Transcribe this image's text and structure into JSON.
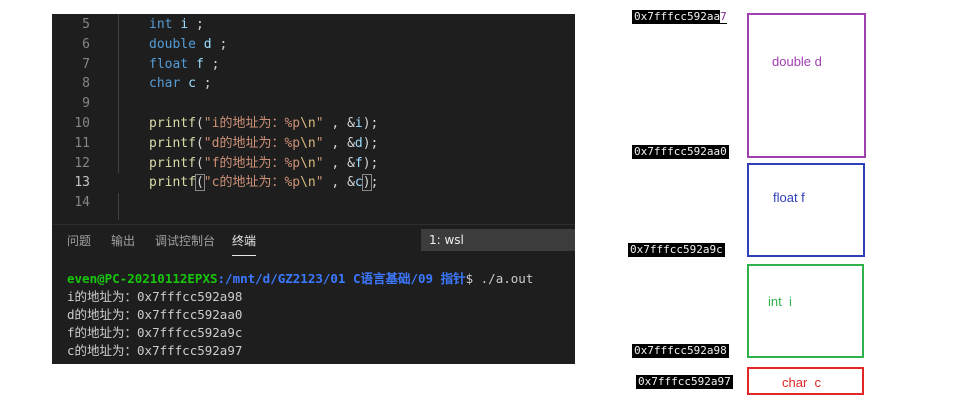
{
  "editor": {
    "lines": [
      {
        "num": "5",
        "current": false,
        "tokens": [
          {
            "t": "int",
            "c": "kw"
          },
          {
            "t": " ",
            "c": "pl"
          },
          {
            "t": "i",
            "c": "id"
          },
          {
            "t": " ;",
            "c": "pl"
          }
        ]
      },
      {
        "num": "6",
        "current": false,
        "tokens": [
          {
            "t": "double",
            "c": "kw"
          },
          {
            "t": " ",
            "c": "pl"
          },
          {
            "t": "d",
            "c": "id"
          },
          {
            "t": " ;",
            "c": "pl"
          }
        ]
      },
      {
        "num": "7",
        "current": false,
        "tokens": [
          {
            "t": "float",
            "c": "kw"
          },
          {
            "t": " ",
            "c": "pl"
          },
          {
            "t": "f",
            "c": "id"
          },
          {
            "t": " ;",
            "c": "pl"
          }
        ]
      },
      {
        "num": "8",
        "current": false,
        "tokens": [
          {
            "t": "char",
            "c": "kw"
          },
          {
            "t": " ",
            "c": "pl"
          },
          {
            "t": "c",
            "c": "id"
          },
          {
            "t": " ;",
            "c": "pl"
          }
        ]
      },
      {
        "num": "9",
        "current": false,
        "tokens": []
      },
      {
        "num": "10",
        "current": false,
        "tokens": [
          {
            "t": "printf",
            "c": "fn"
          },
          {
            "t": "(",
            "c": "pl"
          },
          {
            "t": "\"i的地址为：%p",
            "c": "str"
          },
          {
            "t": "\\n",
            "c": "esc"
          },
          {
            "t": "\"",
            "c": "str"
          },
          {
            "t": " , &",
            "c": "pl"
          },
          {
            "t": "i",
            "c": "id"
          },
          {
            "t": ");",
            "c": "pl"
          }
        ]
      },
      {
        "num": "11",
        "current": false,
        "tokens": [
          {
            "t": "printf",
            "c": "fn"
          },
          {
            "t": "(",
            "c": "pl"
          },
          {
            "t": "\"d的地址为：%p",
            "c": "str"
          },
          {
            "t": "\\n",
            "c": "esc"
          },
          {
            "t": "\"",
            "c": "str"
          },
          {
            "t": " , &",
            "c": "pl"
          },
          {
            "t": "d",
            "c": "id"
          },
          {
            "t": ");",
            "c": "pl"
          }
        ]
      },
      {
        "num": "12",
        "current": false,
        "tokens": [
          {
            "t": "printf",
            "c": "fn"
          },
          {
            "t": "(",
            "c": "pl"
          },
          {
            "t": "\"f的地址为：%p",
            "c": "str"
          },
          {
            "t": "\\n",
            "c": "esc"
          },
          {
            "t": "\"",
            "c": "str"
          },
          {
            "t": " , &",
            "c": "pl"
          },
          {
            "t": "f",
            "c": "id"
          },
          {
            "t": ");",
            "c": "pl"
          }
        ]
      },
      {
        "num": "13",
        "current": true,
        "tokens": [
          {
            "t": "printf",
            "c": "fn"
          },
          {
            "t": "(",
            "c": "pl brk"
          },
          {
            "t": "\"c的地址为：%p",
            "c": "str"
          },
          {
            "t": "\\n",
            "c": "esc"
          },
          {
            "t": "\"",
            "c": "str"
          },
          {
            "t": " , &",
            "c": "pl"
          },
          {
            "t": "c",
            "c": "id"
          },
          {
            "t": ")",
            "c": "pl brk"
          },
          {
            "t": ";",
            "c": "pl"
          }
        ]
      },
      {
        "num": "14",
        "current": false,
        "tokens": []
      }
    ]
  },
  "panel": {
    "tabs": [
      {
        "label": "问题",
        "active": false
      },
      {
        "label": "输出",
        "active": false
      },
      {
        "label": "调试控制台",
        "active": false
      },
      {
        "label": "终端",
        "active": true
      }
    ],
    "terminal_select": "1: wsl"
  },
  "terminal": {
    "prompt_user": "even@PC-20210112EPXS",
    "prompt_path": ":/mnt/d/GZ2123/01 C语言基础/09 指针",
    "prompt_cmd": "$ ./a.out",
    "output": [
      "i的地址为：0x7fffcc592a98",
      "d的地址为：0x7fffcc592aa0",
      "f的地址为：0x7fffcc592a9c",
      "c的地址为：0x7fffcc592a97"
    ]
  },
  "diagram": {
    "addr_top": {
      "main": "0x7fffcc592aa",
      "tail": "7"
    },
    "addr_aa0": "0x7fffcc592aa0",
    "addr_a9c": "0x7fffcc592a9c",
    "addr_a98": "0x7fffcc592a98",
    "addr_a97": "0x7fffcc592a97",
    "boxes": [
      {
        "label": "double d",
        "color": "#a040b0"
      },
      {
        "label": "float f",
        "color": "#2f3fb8"
      },
      {
        "label": "int  i",
        "color": "#2fb24a"
      },
      {
        "label": "char  c",
        "color": "#e02626"
      }
    ]
  }
}
